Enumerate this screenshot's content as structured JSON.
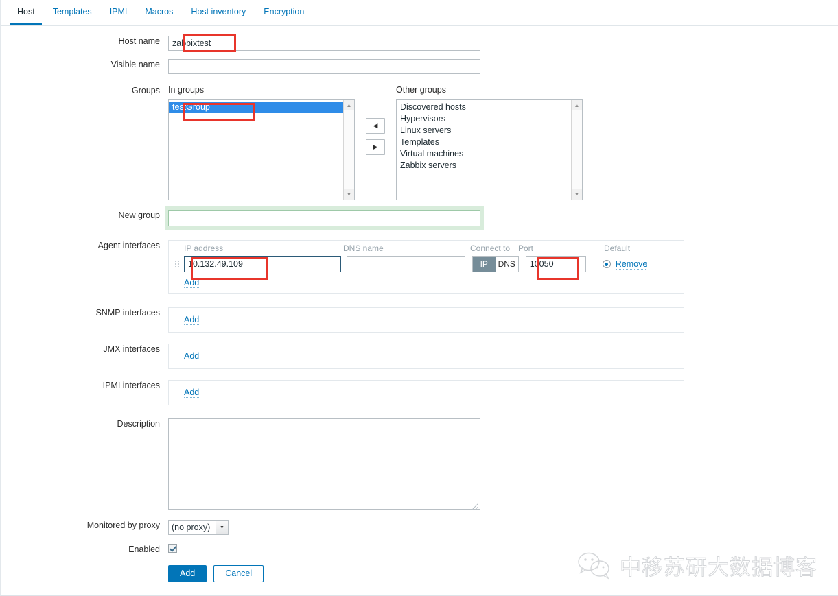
{
  "tabs": [
    {
      "label": "Host",
      "active": true
    },
    {
      "label": "Templates",
      "active": false
    },
    {
      "label": "IPMI",
      "active": false
    },
    {
      "label": "Macros",
      "active": false
    },
    {
      "label": "Host inventory",
      "active": false
    },
    {
      "label": "Encryption",
      "active": false
    }
  ],
  "form": {
    "host_name": {
      "label": "Host name",
      "value": "zabbixtest"
    },
    "visible_name": {
      "label": "Visible name",
      "value": ""
    },
    "groups": {
      "label": "Groups",
      "in_groups_header": "In groups",
      "other_groups_header": "Other groups",
      "in_groups": [
        {
          "label": "testGroup",
          "selected": true
        }
      ],
      "other_groups": [
        {
          "label": "Discovered hosts",
          "selected": false
        },
        {
          "label": "Hypervisors",
          "selected": false
        },
        {
          "label": "Linux servers",
          "selected": false
        },
        {
          "label": "Templates",
          "selected": false
        },
        {
          "label": "Virtual machines",
          "selected": false
        },
        {
          "label": "Zabbix servers",
          "selected": false
        }
      ],
      "move_left_icon": "triangle-left-icon",
      "move_right_icon": "triangle-right-icon"
    },
    "new_group": {
      "label": "New group",
      "value": "",
      "placeholder": ""
    },
    "agent_interfaces": {
      "label": "Agent interfaces",
      "columns": {
        "ip": "IP address",
        "dns": "DNS name",
        "connect_to": "Connect to",
        "port": "Port",
        "default": "Default"
      },
      "rows": [
        {
          "ip": "10.132.49.109",
          "dns": "",
          "connect_to_options": [
            "IP",
            "DNS"
          ],
          "connect_to_selected": "IP",
          "port": "10050",
          "default_selected": true,
          "remove_label": "Remove"
        }
      ],
      "add_label": "Add"
    },
    "snmp_interfaces": {
      "label": "SNMP interfaces",
      "add_label": "Add"
    },
    "jmx_interfaces": {
      "label": "JMX interfaces",
      "add_label": "Add"
    },
    "ipmi_interfaces": {
      "label": "IPMI interfaces",
      "add_label": "Add"
    },
    "description": {
      "label": "Description",
      "value": ""
    },
    "monitored_by_proxy": {
      "label": "Monitored by proxy",
      "selected": "(no proxy)",
      "options": [
        "(no proxy)"
      ]
    },
    "enabled": {
      "label": "Enabled",
      "checked": true
    },
    "buttons": {
      "submit": "Add",
      "cancel": "Cancel"
    }
  },
  "annotations": {
    "color": "#e8352b",
    "boxes": [
      "host-name-field",
      "in-groups-selected-item",
      "ip-address-field",
      "port-field"
    ]
  },
  "watermark": {
    "text": "中移苏研大数据博客",
    "icon": "wechat-icon"
  },
  "colors": {
    "accent": "#0275b8",
    "selection": "#2f8ce8",
    "annotation": "#e8352b",
    "segment_active": "#768d99",
    "focus_green": "#9ec9a8"
  }
}
